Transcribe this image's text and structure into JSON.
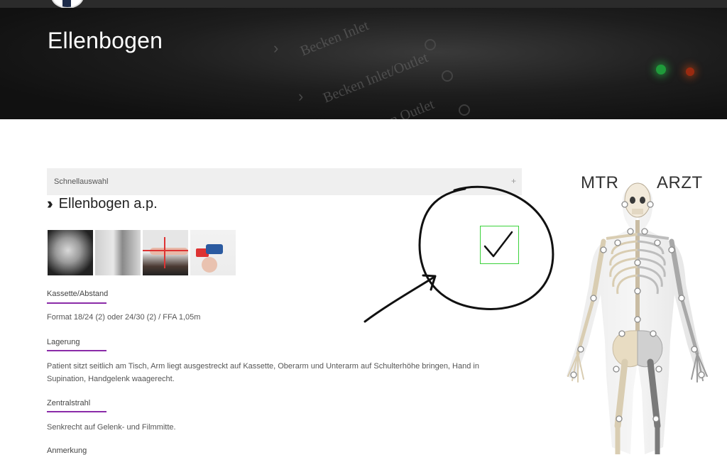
{
  "hero": {
    "title": "Ellenbogen",
    "background_texts": [
      "Becken Inlet",
      "Becken Inlet/Outlet",
      "Becken Outlet"
    ]
  },
  "accordion": {
    "label": "Schnellauswahl",
    "toggle_symbol": "+"
  },
  "section": {
    "title": "Ellenbogen a.p."
  },
  "thumbnails": [
    "x-ray-elbow",
    "x-ray-machine",
    "arm-positioning",
    "arm-with-blood-pressure-cuff"
  ],
  "fields": [
    {
      "label": "Kassette/Abstand",
      "text": "Format 18/24 (2) oder 24/30 (2) / FFA 1,05m"
    },
    {
      "label": "Lagerung",
      "text": "Patient sitzt seitlich am Tisch, Arm liegt ausgestreckt auf Kassette, Oberarm und Unterarm auf Schulterhöhe bringen, Hand in Supination, Handgelenk waagerecht."
    },
    {
      "label": "Zentralstrahl",
      "text": "Senkrecht auf Gelenk- und Filmmitte."
    },
    {
      "label": "Anmerkung",
      "text": ""
    }
  ],
  "skeleton": {
    "left_label": "MTR",
    "right_label": "ARZT"
  },
  "annotation": {
    "check_icon": "checkmark-icon",
    "colors": {
      "check_border": "#3bd23b",
      "accent_rule": "#8a2ba8"
    }
  }
}
